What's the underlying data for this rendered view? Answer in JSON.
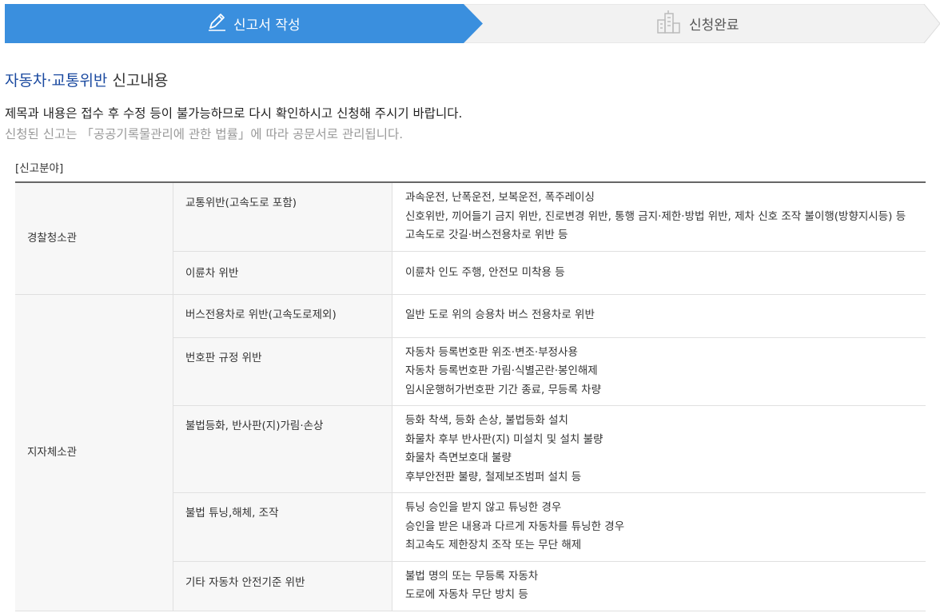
{
  "steps": [
    {
      "label": "신고서 작성",
      "icon": "pencil-icon",
      "active": true
    },
    {
      "label": "신청완료",
      "icon": "building-icon",
      "active": false
    }
  ],
  "section": {
    "title_accent": "자동차·교통위반",
    "title_rest": " 신고내용"
  },
  "notices": [
    "제목과 내용은 접수 후 수정 등이 불가능하므로 다시 확인하시고 신청해 주시기 바랍니다.",
    "신청된 신고는 「공공기록물관리에 관한 법률」에 따라 공문서로 관리됩니다."
  ],
  "category_label": "[신고분야]",
  "colors": {
    "accent": "#3a8fde",
    "title": "#1b4aa0"
  },
  "table": [
    {
      "dept": "경찰청소관",
      "rows": [
        {
          "type": "교통위반(고속도로 포함)",
          "desc": [
            "과속운전, 난폭운전, 보복운전, 폭주레이싱",
            "신호위반, 끼어들기 금지 위반, 진로변경 위반, 통행 금지·제한·방법 위반, 제차 신호 조작 불이행(방향지시등) 등",
            "고속도로 갓길·버스전용차로 위반 등"
          ]
        },
        {
          "type": "이륜차 위반",
          "desc": [
            "이륜차 인도 주행, 안전모 미착용 등"
          ]
        }
      ]
    },
    {
      "dept": "지자체소관",
      "rows": [
        {
          "type": "버스전용차로 위반(고속도로제외)",
          "desc": [
            "일반 도로 위의 승용차 버스 전용차로 위반"
          ]
        },
        {
          "type": "번호판 규정 위반",
          "desc": [
            "자동차 등록번호판 위조·변조·부정사용",
            "자동차 등록번호판 가림·식별곤란·봉인해제",
            "임시운행허가번호판 기간 종료, 무등록 차량"
          ]
        },
        {
          "type": "불법등화, 반사판(지)가림·손상",
          "desc": [
            "등화 착색, 등화 손상, 불법등화 설치",
            "화물차 후부 반사판(지) 미설치 및 설치 불량",
            "화물차 측면보호대 불량",
            "후부안전판 불량, 철제보조범퍼 설치 등"
          ]
        },
        {
          "type": "불법 튜닝,해체, 조작",
          "desc": [
            "튜닝 승인을 받지 않고 튜닝한 경우",
            "승인을 받은 내용과 다르게 자동차를 튜닝한 경우",
            "최고속도 제한장치 조작 또는 무단 해제"
          ]
        },
        {
          "type": "기타 자동차 안전기준 위반",
          "desc": [
            "불법 명의 또는 무등록 자동차",
            "도로에 자동차 무단 방치 등"
          ]
        }
      ]
    }
  ]
}
